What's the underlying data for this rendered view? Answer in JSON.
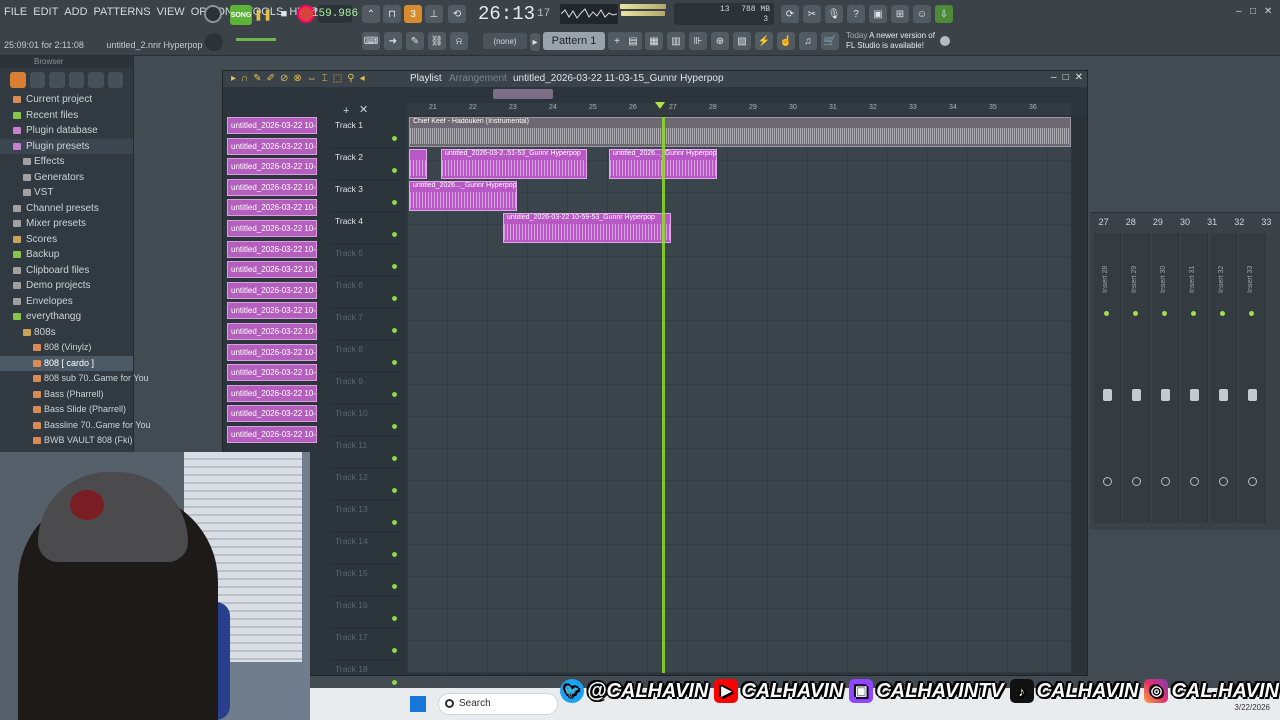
{
  "menu": [
    "FILE",
    "EDIT",
    "ADD",
    "PATTERNS",
    "VIEW",
    "OPTIONS",
    "TOOLS",
    "HELP"
  ],
  "transport": {
    "song_label": "SONG",
    "play_icon": "pause",
    "tempo": "159.986",
    "time": "26:13",
    "time_sub": "17",
    "cpu_a": "13",
    "mem": "788 MB",
    "voices": "3"
  },
  "hint": {
    "time_info": "25:09:01 for 2:11:08",
    "file": "untitled_2.nnr Hyperpop"
  },
  "toolbar": {
    "snap_value": "(none)",
    "pattern": "Pattern 1"
  },
  "news": {
    "today": "Today",
    "message": "A newer version of FL Studio is available!"
  },
  "browser": {
    "title": "Browser",
    "items": [
      {
        "label": "Current project",
        "level": 1,
        "color": "o"
      },
      {
        "label": "Recent files",
        "level": 1,
        "color": "g"
      },
      {
        "label": "Plugin database",
        "level": 1,
        "color": "p"
      },
      {
        "label": "Plugin presets",
        "level": 1,
        "color": "p"
      },
      {
        "label": "Effects",
        "level": 2,
        "color": ""
      },
      {
        "label": "Generators",
        "level": 2,
        "color": ""
      },
      {
        "label": "VST",
        "level": 2,
        "color": ""
      },
      {
        "label": "Channel presets",
        "level": 1,
        "color": ""
      },
      {
        "label": "Mixer presets",
        "level": 1,
        "color": ""
      },
      {
        "label": "Scores",
        "level": 1,
        "color": "y"
      },
      {
        "label": "Backup",
        "level": 1,
        "color": "g"
      },
      {
        "label": "Clipboard files",
        "level": 1,
        "color": "b"
      },
      {
        "label": "Demo projects",
        "level": 1,
        "color": "b"
      },
      {
        "label": "Envelopes",
        "level": 1,
        "color": "b"
      },
      {
        "label": "everythangg",
        "level": 1,
        "color": "g"
      },
      {
        "label": "808s",
        "level": 2,
        "color": "y"
      },
      {
        "label": "808 (Vinylz)",
        "level": 3,
        "color": "o"
      },
      {
        "label": "808 [ cardo ]",
        "level": 3,
        "color": "o"
      },
      {
        "label": "808 sub 70..Game for You",
        "level": 3,
        "color": "o"
      },
      {
        "label": "Bass (Pharrell)",
        "level": 3,
        "color": "o"
      },
      {
        "label": "Bass Slide (Pharrell)",
        "level": 3,
        "color": "o"
      },
      {
        "label": "Bassline 70..Game for You",
        "level": 3,
        "color": "o"
      },
      {
        "label": "BWB VAULT 808 (Fki)",
        "level": 3,
        "color": "o"
      }
    ]
  },
  "playlist": {
    "title": "Playlist",
    "mode": "Arrangement",
    "file": "untitled_2026-03-22 11-03-15_Gunnr Hyperpop",
    "ruler": [
      "21",
      "22",
      "23",
      "24",
      "25",
      "26",
      "27",
      "28",
      "29",
      "30",
      "31",
      "32",
      "33",
      "34",
      "35",
      "36"
    ],
    "pattern_items": [
      "untitled_2026-03-22 10-",
      "untitled_2026-03-22 10-",
      "untitled_2026-03-22 10-",
      "untitled_2026-03-22 10-",
      "untitled_2026-03-22 10-",
      "untitled_2026-03-22 10-",
      "untitled_2026-03-22 10-",
      "untitled_2026-03-22 10-",
      "untitled_2026-03-22 10-",
      "untitled_2026-03-22 10-",
      "untitled_2026-03-22 10-",
      "untitled_2026-03-22 10-",
      "untitled_2026-03-22 10-",
      "untitled_2026-03-22 10-",
      "untitled_2026-03-22 10-",
      "untitled_2026-03-22 10-"
    ],
    "tracks": [
      "Track 1",
      "Track 2",
      "Track 3",
      "Track 4",
      "Track 5",
      "Track 6",
      "Track 7",
      "Track 8",
      "Track 9",
      "Track 10",
      "Track 11",
      "Track 12",
      "Track 13",
      "Track 14",
      "Track 15",
      "Track 16",
      "Track 17",
      "Track 18"
    ],
    "clips": {
      "c1": "Chief Keef - Hadouken (Instrumental)",
      "c2": "untitled_2026-03-2..51-53_Gunnr Hyperpop",
      "c3": "untitled_2026..._Gunnr Hyperpop",
      "c4": "untitled_2026..._Gunnr Hyperpop",
      "c5": "untitled_2026-03-22 10-59-53_Gunnr Hyperpop"
    }
  },
  "mixer": {
    "headers": [
      "27",
      "28",
      "29",
      "30",
      "31",
      "32",
      "33"
    ],
    "inserts": [
      "Insert 28",
      "Insert 29",
      "Insert 30",
      "Insert 31",
      "Insert 32",
      "Insert 33"
    ]
  },
  "taskbar": {
    "search": "Search",
    "date": "3/22/2026"
  },
  "socials": {
    "twitter": "@CALHAVIN",
    "youtube": "CALHAVIN",
    "twitch": "CALHAVINTV",
    "tiktok": "CALHAVIN",
    "instagram": "CAL.HAVIN"
  }
}
